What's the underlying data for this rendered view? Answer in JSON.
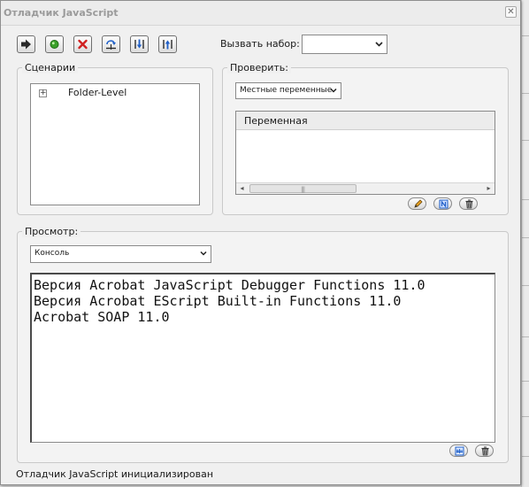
{
  "window": {
    "title": "Отладчик JavaScript",
    "close_glyph": "✕"
  },
  "toolbar": {
    "buttons": [
      {
        "name": "resume",
        "icon": "arrow-right-icon"
      },
      {
        "name": "break",
        "icon": "green-circle-icon"
      },
      {
        "name": "stop",
        "icon": "red-x-icon"
      },
      {
        "name": "step-over",
        "icon": "step-over-icon"
      },
      {
        "name": "step-into",
        "icon": "step-into-icon"
      },
      {
        "name": "step-out",
        "icon": "step-out-icon"
      }
    ],
    "call_stack_label": "Вызвать набор:",
    "call_stack_value": ""
  },
  "scripts": {
    "legend": "Сценарии",
    "items": [
      {
        "label": "Folder-Level",
        "expander": "+"
      }
    ]
  },
  "inspect": {
    "legend": "Проверить:",
    "scope_value": "Местные переменные",
    "column_header": "Переменная",
    "grip": "|||",
    "buttons": [
      "edit-pencil-icon",
      "variable-icon",
      "trash-icon"
    ]
  },
  "view": {
    "legend": "Просмотр:",
    "mode_value": "Консоль",
    "console_lines": [
      "Версия Acrobat JavaScript Debugger Functions 11.0",
      "Версия Acrobat EScript Built-in Functions 11.0",
      "Acrobat SOAP 11.0"
    ],
    "buttons": [
      "js-icon",
      "trash-icon"
    ]
  },
  "status": "Отладчик JavaScript инициализирован",
  "colors": {
    "accent_blue": "#1f5fc8",
    "stop_red": "#d02020",
    "go_green": "#3aa02a"
  }
}
